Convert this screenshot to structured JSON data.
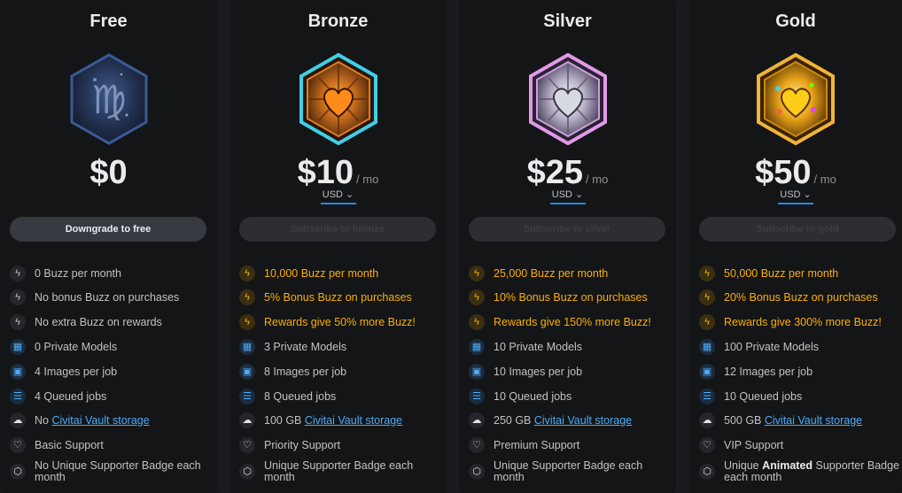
{
  "plans": [
    {
      "title": "Free",
      "price": "$0",
      "per": "",
      "currency": "",
      "cta": "Downgrade to free",
      "features": {
        "buzz_month": "0 Buzz per month",
        "bonus": "No bonus Buzz on purchases",
        "rewards": "No extra Buzz on rewards",
        "models": "0 Private Models",
        "images": "4 Images per job",
        "queue": "4 Queued jobs",
        "vault_prefix": "No ",
        "vault_link": "Civitai Vault storage",
        "support": "Basic Support",
        "badge": "No Unique Supporter Badge each month"
      }
    },
    {
      "title": "Bronze",
      "price": "$10",
      "per": "/ mo",
      "currency": "USD ⌄",
      "cta": "Subscribe to bronze",
      "features": {
        "buzz_month": "10,000 Buzz per month",
        "bonus": "5% Bonus Buzz on purchases",
        "rewards": "Rewards give 50% more Buzz!",
        "models": "3 Private Models",
        "images": "8 Images per job",
        "queue": "8 Queued jobs",
        "vault_prefix": "100 GB ",
        "vault_link": "Civitai Vault storage",
        "support": "Priority Support",
        "badge": "Unique Supporter Badge each month"
      }
    },
    {
      "title": "Silver",
      "price": "$25",
      "per": "/ mo",
      "currency": "USD ⌄",
      "cta": "Subscribe to silver",
      "features": {
        "buzz_month": "25,000 Buzz per month",
        "bonus": "10% Bonus Buzz on purchases",
        "rewards": "Rewards give 150% more Buzz!",
        "models": "10 Private Models",
        "images": "10 Images per job",
        "queue": "10 Queued jobs",
        "vault_prefix": "250 GB ",
        "vault_link": "Civitai Vault storage",
        "support": "Premium Support",
        "badge": "Unique Supporter Badge each month"
      }
    },
    {
      "title": "Gold",
      "price": "$50",
      "per": "/ mo",
      "currency": "USD ⌄",
      "cta": "Subscribe to gold",
      "features": {
        "buzz_month": "50,000 Buzz per month",
        "bonus": "20% Bonus Buzz on purchases",
        "rewards": "Rewards give 300% more Buzz!",
        "models": "100 Private Models",
        "images": "12 Images per job",
        "queue": "10 Queued jobs",
        "vault_prefix": "500 GB ",
        "vault_link": "Civitai Vault storage",
        "support": "VIP Support",
        "badge_pre": "Unique ",
        "badge_bold": "Animated",
        "badge_post": " Supporter Badge each month"
      }
    }
  ],
  "icons": {
    "bolt": "bolt-icon",
    "models": "grid-icon",
    "images": "photo-ai-icon",
    "queue": "list-icon",
    "vault": "cloud-icon",
    "support": "heart-handshake-icon",
    "badge": "hexagon-icon",
    "badge_gold": "hexagon-plus-icon"
  },
  "colors": {
    "background": "#1a1b1e",
    "card": "#141517",
    "accent_gold": "#fab005",
    "link_blue": "#4dabf7",
    "free_badge": "#2b3a5c",
    "bronze_badge": "#c46a1c",
    "silver_badge": "#c9a0dc",
    "gold_badge": "#e8a317"
  }
}
